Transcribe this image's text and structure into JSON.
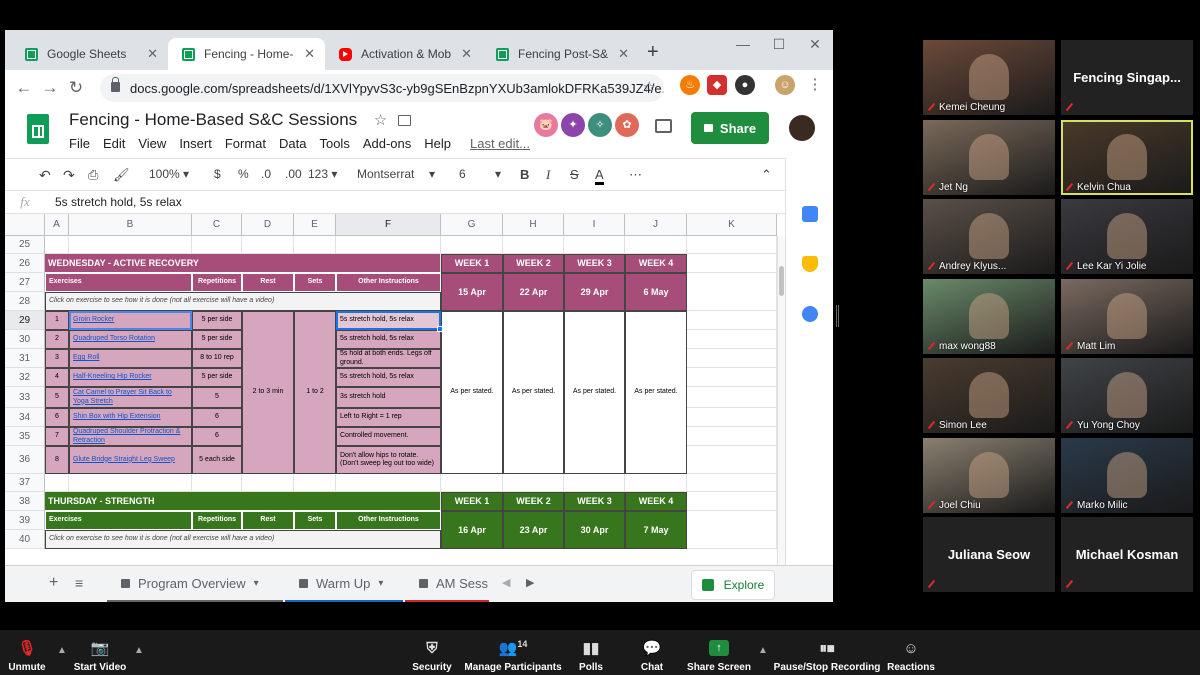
{
  "browser": {
    "tabs": [
      {
        "title": "Google Sheets",
        "icon": "sheets-icon"
      },
      {
        "title": "Fencing - Home-Bas",
        "icon": "sheets-icon"
      },
      {
        "title": "Activation & Mobilis",
        "icon": "youtube-icon"
      },
      {
        "title": "Fencing Post-S&C Se",
        "icon": "sheets-icon"
      }
    ],
    "new_tab": "+",
    "url": "docs.google.com/spreadsheets/d/1XVlYpyvS3c-yb9gSEnBzpnYXUb3amlokDFRKa539JZ4/e..."
  },
  "sheet": {
    "title": "Fencing - Home-Based S&C Sessions",
    "menu": [
      "File",
      "Edit",
      "View",
      "Insert",
      "Format",
      "Data",
      "Tools",
      "Add-ons",
      "Help",
      "Last edit..."
    ],
    "share_label": "Share",
    "toolbar": {
      "zoom": "100%",
      "currency": "$",
      "percent": "%",
      "dec1": ".0",
      "dec2": ".00",
      "format": "123",
      "font": "Montserrat",
      "size": "6",
      "bold": "B",
      "italic": "I",
      "strike": "S",
      "textcolor": "A",
      "more": "⋯"
    },
    "fx_label": "fx",
    "formula": "5s stretch hold, 5s relax",
    "columns": [
      "A",
      "B",
      "C",
      "D",
      "E",
      "F",
      "G",
      "H",
      "I",
      "J",
      "K"
    ],
    "rows": [
      "25",
      "26",
      "27",
      "28",
      "29",
      "30",
      "31",
      "32",
      "33",
      "34",
      "35",
      "36",
      "37",
      "38",
      "39",
      "40"
    ],
    "wednesday": {
      "title": "WEDNESDAY - ACTIVE RECOVERY",
      "headers": [
        "Exercises",
        "Repetitions",
        "Rest",
        "Sets",
        "Other Instructions"
      ],
      "weeks": [
        "WEEK 1",
        "WEEK 2",
        "WEEK 3",
        "WEEK 4"
      ],
      "dates": [
        "15 Apr",
        "22 Apr",
        "29 Apr",
        "6 May"
      ],
      "note": "Click on exercise to see how it is done (not all exercise will have a video)",
      "exercises": [
        {
          "n": "1",
          "name": "Groin Rocker",
          "reps": "5 per side",
          "other": "5s stretch hold, 5s relax"
        },
        {
          "n": "2",
          "name": "Quadruped Torso Rotation",
          "reps": "5 per side",
          "other": "5s stretch hold, 5s relax"
        },
        {
          "n": "3",
          "name": "Egg Roll",
          "reps": "8 to 10 rep",
          "other": "5s hold at both ends. Legs off ground."
        },
        {
          "n": "4",
          "name": "Half-Kneeling Hip Rocker",
          "reps": "5 per side",
          "other": "5s stretch hold, 5s relax"
        },
        {
          "n": "5",
          "name": "Cat Camel to Prayer Sit Back to Yoga Stretch",
          "reps": "5",
          "other": "3s stretch hold"
        },
        {
          "n": "6",
          "name": "Shin Box with Hip Extension",
          "reps": "6",
          "other": "Left to Right = 1 rep"
        },
        {
          "n": "7",
          "name": "Quadruped Shoulder Protraction & Retraction",
          "reps": "6",
          "other": "Controlled movement."
        },
        {
          "n": "8",
          "name": "Glute Bridge Straight Leg Sweep",
          "reps": "5 each side",
          "other": "Don't allow hips to rotate. (Don't sweep leg out too wide)"
        }
      ],
      "rest": "2 to 3 min",
      "sets": "1 to 2",
      "as_stated": "As per stated."
    },
    "thursday": {
      "title": "THURSDAY - STRENGTH",
      "headers": [
        "Exercises",
        "Repetitions",
        "Rest",
        "Sets",
        "Other Instructions"
      ],
      "weeks": [
        "WEEK 1",
        "WEEK 2",
        "WEEK 3",
        "WEEK 4"
      ],
      "dates": [
        "16 Apr",
        "23 Apr",
        "30 Apr",
        "7 May"
      ],
      "note": "Click on exercise to see how it is done (not all exercise will have a video)"
    },
    "sheet_tabs": [
      "Program Overview",
      "Warm Up",
      "AM Sess"
    ],
    "explore": "Explore"
  },
  "participants": [
    {
      "name": "Kemei Cheung",
      "video": true
    },
    {
      "name": "Fencing  Singap...",
      "video": false
    },
    {
      "name": "Jet Ng",
      "video": true
    },
    {
      "name": "Kelvin Chua",
      "video": true,
      "speaking": true
    },
    {
      "name": "Andrey Klyus...",
      "video": true
    },
    {
      "name": "Lee Kar Yi Jolie",
      "video": true
    },
    {
      "name": "max wong88",
      "video": true
    },
    {
      "name": "Matt Lim",
      "video": true
    },
    {
      "name": "Simon Lee",
      "video": true
    },
    {
      "name": "Yu Yong Choy",
      "video": true
    },
    {
      "name": "Joel Chiu",
      "video": true
    },
    {
      "name": "Marko Milic",
      "video": true
    },
    {
      "name": "Juliana Seow",
      "video": false
    },
    {
      "name": "Michael Kosman",
      "video": false
    }
  ],
  "zoom_controls": {
    "unmute": "Unmute",
    "start_video": "Start Video",
    "security": "Security",
    "participants": "Manage Participants",
    "participant_count": "14",
    "polls": "Polls",
    "chat": "Chat",
    "share": "Share Screen",
    "record": "Pause/Stop Recording",
    "reactions": "Reactions"
  },
  "colors": {
    "wednesday": "#a64d79",
    "wednesday_light": "#d5a6bd",
    "thursday": "#38761d",
    "chrome_tabbar": "#dee1e6",
    "share_green": "#1e8e3e"
  }
}
